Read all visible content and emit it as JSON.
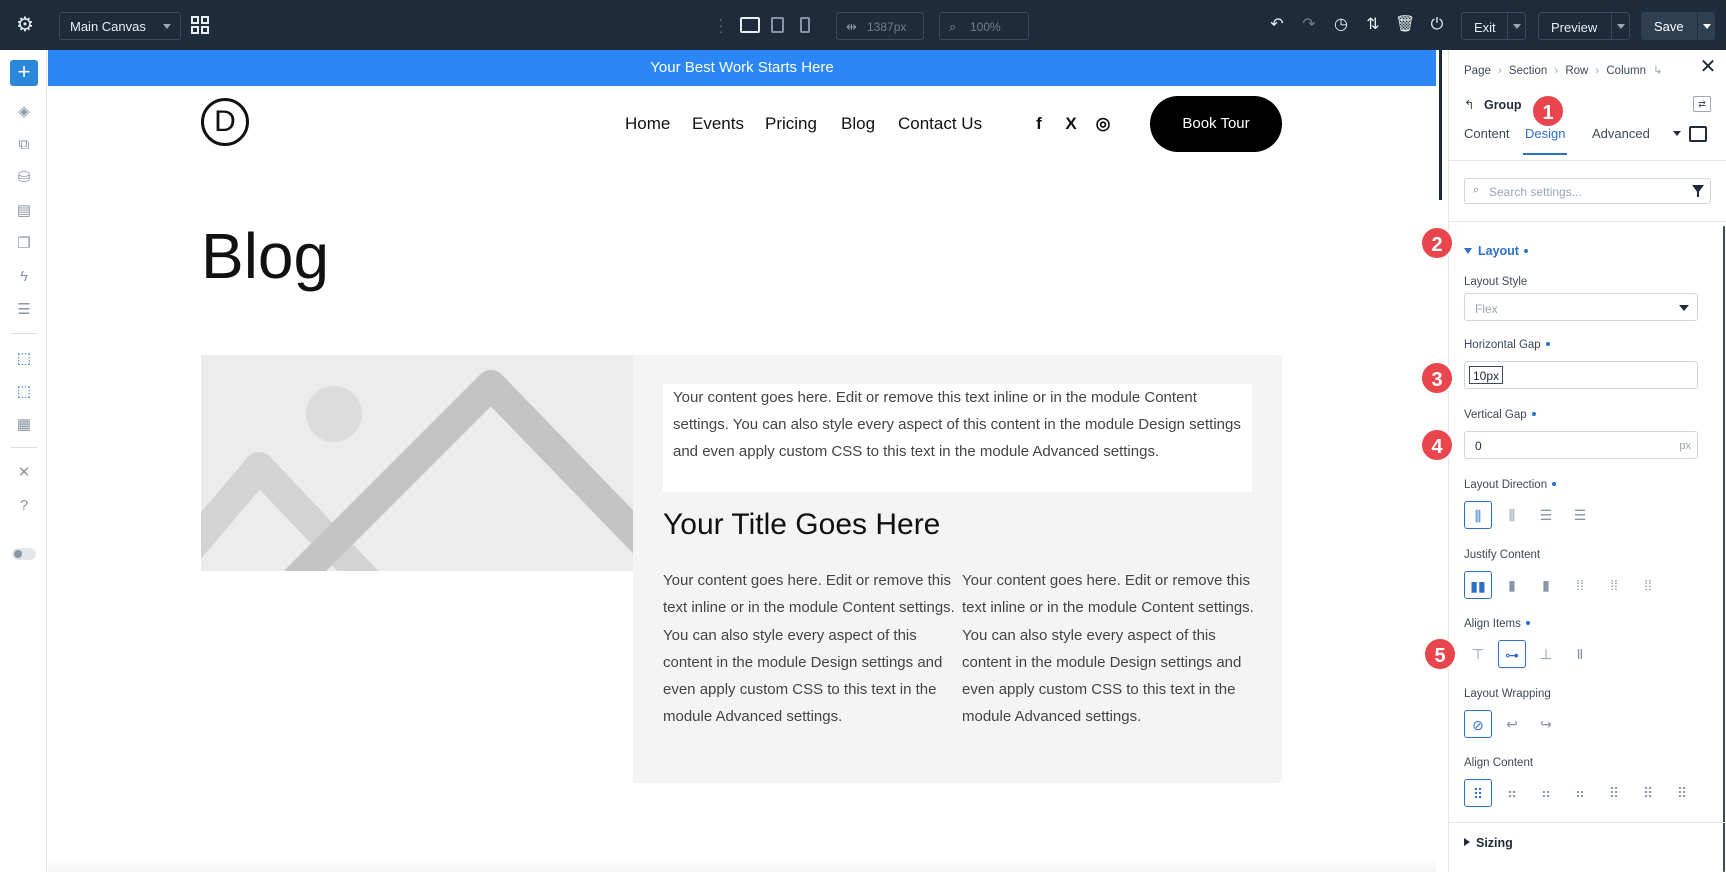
{
  "topbar": {
    "canvas_select": "Main Canvas",
    "width_value": "1387px",
    "zoom_value": "100%",
    "exit_label": "Exit",
    "preview_label": "Preview",
    "save_label": "Save"
  },
  "canvas": {
    "banner": "Your Best Work Starts Here",
    "logo_letter": "D",
    "nav": [
      "Home",
      "Events",
      "Pricing",
      "Blog",
      "Contact Us"
    ],
    "book_button": "Book Tour",
    "page_heading": "Blog",
    "card": {
      "intro": "Your content goes here. Edit or remove this text inline or in the module Content settings. You can also style every aspect of this content in the module Design settings and even apply custom CSS to this text in the module Advanced settings.",
      "title": "Your Title Goes Here",
      "col1": "Your content goes here. Edit or remove this text inline or in the module Content settings. You can also style every aspect of this content in the module Design settings and even apply custom CSS to this text in the module Advanced settings.",
      "col2": "Your content goes here. Edit or remove this text inline or in the module Content settings. You can also style every aspect of this content in the module Design settings and even apply custom CSS to this text in the module Advanced settings."
    }
  },
  "panel": {
    "breadcrumb": [
      "Page",
      "Section",
      "Row",
      "Column"
    ],
    "group_label": "Group",
    "tabs": [
      "Content",
      "Design",
      "Advanced"
    ],
    "active_tab": "Design",
    "search_placeholder": "Search settings...",
    "layout_section": "Layout",
    "layout_style_label": "Layout Style",
    "layout_style_value": "Flex",
    "horizontal_gap_label": "Horizontal Gap",
    "horizontal_gap_value": "10px",
    "vertical_gap_label": "Vertical Gap",
    "vertical_gap_value": "0",
    "vertical_gap_unit": "px",
    "layout_direction_label": "Layout Direction",
    "justify_content_label": "Justify Content",
    "align_items_label": "Align Items",
    "layout_wrapping_label": "Layout Wrapping",
    "align_content_label": "Align Content",
    "sizing_section": "Sizing"
  },
  "steps": [
    "1",
    "2",
    "3",
    "4",
    "5"
  ],
  "colors": {
    "accent": "#2b6fc9",
    "banner": "#2b87f7",
    "topbar": "#1e2b3a",
    "step_badge": "#e8454d"
  }
}
